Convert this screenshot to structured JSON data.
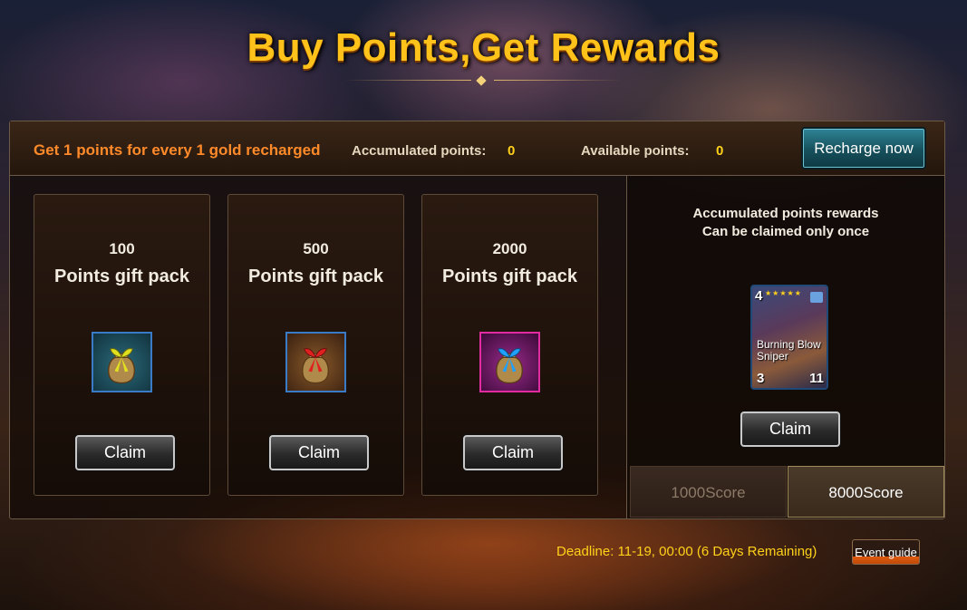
{
  "header": {
    "title": "Buy Points,Get Rewards"
  },
  "topbar": {
    "rate_text": "Get 1 points for every 1 gold recharged",
    "accumulated_label": "Accumulated points:",
    "accumulated_value": "0",
    "available_label": "Available points:",
    "available_value": "0",
    "recharge_label": "Recharge now"
  },
  "packs": [
    {
      "points": "100",
      "label": "Points gift pack",
      "icon": "gift-bag-icon",
      "ribbon_color": "#e0e020",
      "claim_label": "Claim"
    },
    {
      "points": "500",
      "label": "Points gift pack",
      "icon": "gift-bag-icon",
      "ribbon_color": "#e02020",
      "claim_label": "Claim"
    },
    {
      "points": "2000",
      "label": "Points gift pack",
      "icon": "gift-bag-icon",
      "ribbon_color": "#20a0ff",
      "claim_label": "Claim"
    }
  ],
  "rewards": {
    "title_line1": "Accumulated points rewards",
    "title_line2": "Can be claimed only once",
    "card": {
      "cost": "4",
      "name": "Burning Blow Sniper",
      "attack": "3",
      "health": "11",
      "stars": "★★★★★"
    },
    "claim_label": "Claim",
    "tabs": [
      {
        "label": "1000Score",
        "active": false
      },
      {
        "label": "8000Score",
        "active": true
      }
    ]
  },
  "footer": {
    "deadline": "Deadline: 11-19, 00:00 (6 Days Remaining)",
    "guide_label": "Event guide"
  },
  "colors": {
    "title": "#ffc21a",
    "rate_text": "#ff8a2a",
    "value": "#ffd21a",
    "recharge_button": "#16505c"
  }
}
